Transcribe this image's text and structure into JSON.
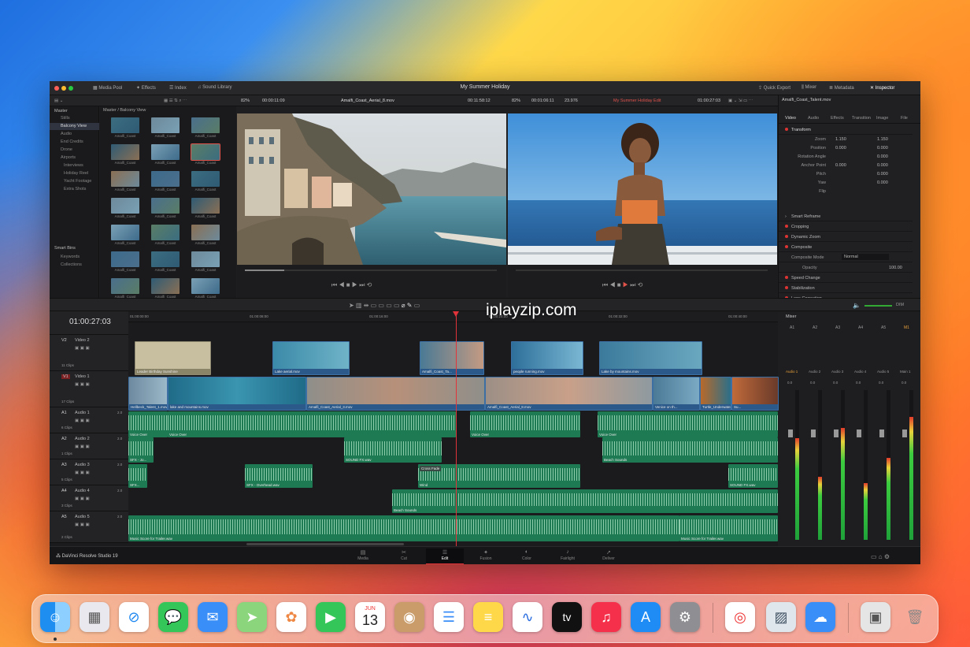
{
  "app": {
    "title": "My Summer Holiday",
    "brand": "DaVinci Resolve Studio 19"
  },
  "toolbar": {
    "left": [
      "Media Pool",
      "Effects",
      "Index",
      "Sound Library"
    ],
    "right": [
      "Quick Export",
      "Mixer",
      "Metadata",
      "Inspector"
    ]
  },
  "source_viewer": {
    "zoom": "82%",
    "timecode_in": "00:00:11:09",
    "clip_name": "Amalfi_Coast_Aerial_8.mov",
    "timecode_out": "00:11:58:12"
  },
  "timeline_viewer": {
    "zoom": "82%",
    "duration": "00:01:06:11",
    "fps": "23.976",
    "timeline_name": "My Summer Holiday Edit",
    "timecode": "01:00:27:03"
  },
  "media_pool": {
    "path": "Master / Balcony View",
    "bins": [
      "Master",
      "Stills",
      "Balcony View",
      "Audio",
      "End Credits",
      "Drone",
      "Airports",
      "Interviews",
      "Holiday Reel",
      "Yacht Footage",
      "Extra Shots"
    ],
    "smart_bins_label": "Smart Bins",
    "smart_bins": [
      "Keywords",
      "Collections"
    ],
    "clips": [
      "Amalfi_Coast",
      "Amalfi_Coast",
      "Amalfi_Coast",
      "Amalfi_Coast",
      "Amalfi_Coast",
      "Amalfi_Coast",
      "Amalfi_Coast",
      "Amalfi_Coast",
      "Amalfi_Coast",
      "Amalfi_Coast",
      "Amalfi_Coast",
      "Amalfi_Coast",
      "Amalfi_Coast",
      "Amalfi_Coast",
      "Amalfi_Coast",
      "Amalfi_Coast",
      "Amalfi_Coast",
      "Amalfi_Coast",
      "Amalfi_Coast",
      "Amalfi_Coast",
      "Amalfi_Coast",
      "Balcony_view",
      "Waterfall_tag",
      "Holiday_Track"
    ]
  },
  "inspector": {
    "clip_name": "Amalfi_Coast_Talent.mov",
    "tabs": [
      "Video",
      "Audio",
      "Effects",
      "Transition",
      "Image",
      "File"
    ],
    "transform_label": "Transform",
    "rows": [
      {
        "label": "Zoom",
        "x": "1.150",
        "y": "1.150"
      },
      {
        "label": "Position",
        "x": "0.000",
        "y": "0.000"
      },
      {
        "label": "Rotation Angle",
        "x": "",
        "y": "0.000"
      },
      {
        "label": "Anchor Point",
        "x": "0.000",
        "y": "0.000"
      },
      {
        "label": "Pitch",
        "x": "",
        "y": "0.000"
      },
      {
        "label": "Yaw",
        "x": "",
        "y": "0.000"
      },
      {
        "label": "Flip",
        "x": "",
        "y": ""
      }
    ],
    "sections": [
      "Smart Reframe",
      "Cropping",
      "Dynamic Zoom",
      "Composite"
    ],
    "composite_mode_label": "Composite Mode",
    "composite_mode_value": "Normal",
    "opacity_label": "Opacity",
    "opacity_value": "100.00",
    "more_sections": [
      "Speed Change",
      "Stabilization",
      "Lens Correction"
    ]
  },
  "timeline": {
    "timecode": "01:00:27:03",
    "ruler": [
      "01:00:00:00",
      "01:00:08:00",
      "01:00:16:00",
      "01:00:24:00",
      "01:00:32:00",
      "01:00:40:00"
    ],
    "tracks": [
      {
        "id": "V2",
        "name": "Video 2",
        "clips": "11 Clips"
      },
      {
        "id": "V1",
        "name": "Video 1",
        "clips": "17 Clips"
      },
      {
        "id": "A1",
        "name": "Audio 1",
        "clips": "6 Clips",
        "ch": "2.0"
      },
      {
        "id": "A2",
        "name": "Audio 2",
        "clips": "1 Clips",
        "ch": "2.0"
      },
      {
        "id": "A3",
        "name": "Audio 3",
        "clips": "5 Clips",
        "ch": "2.0"
      },
      {
        "id": "A4",
        "name": "Audio 4",
        "clips": "3 Clips",
        "ch": "2.0"
      },
      {
        "id": "A5",
        "name": "Audio 5",
        "clips": "2 Clips",
        "ch": "2.0"
      }
    ],
    "v2_clips": [
      "Leader Birthday Sunshine",
      "Lake aerial.mov",
      "Amalfi_Coast_Ta...",
      "people running.mov",
      "Lake by mountains.mov"
    ],
    "v1_clips": [
      "Hellbeck_Talent_1.mov",
      "lake and mountains.mov",
      "Amalfi_Coast_Aerial_3.mov",
      "Amalfi_Coast_Aerial_8.mov",
      "Venice on th...",
      "Turtle_Underwater...",
      "Su..."
    ],
    "a1_clips": [
      "Voice Over",
      "Voice Over",
      "Voice Over",
      "Voice Over"
    ],
    "a2_clips": [
      "SFX - Jo...",
      "SOUND FX.wav",
      "Beach Sounds"
    ],
    "a3_clips": [
      "SFX...",
      "SFX - Overhead.wav",
      "Wind",
      "SOUND FX.wav"
    ],
    "a3_label": "Cross Fade",
    "a4_clips": [
      "Beach Sounds"
    ],
    "a5_clips": [
      "Music Score for Trailer.wav",
      "Music Score for Trailer.wav"
    ]
  },
  "mixer": {
    "title": "Mixer",
    "inputs": [
      "A1",
      "A2",
      "A3",
      "A4",
      "A5",
      "M1"
    ],
    "channels": [
      "Audio 1",
      "Audio 2",
      "Audio 3",
      "Audio 4",
      "Audio 5",
      "Main 1"
    ],
    "level": "DIM",
    "db_label": "0.0",
    "meter_levels": [
      0.68,
      0.42,
      0.75,
      0.38,
      0.55,
      0.82
    ]
  },
  "pages": [
    "Media",
    "Cut",
    "Edit",
    "Fusion",
    "Color",
    "Fairlight",
    "Deliver"
  ],
  "active_page": "Edit",
  "watermark": "iplayzip.com",
  "dock": {
    "apps": [
      "Finder",
      "Launchpad",
      "Safari",
      "Messages",
      "Mail",
      "Maps",
      "Photos",
      "FaceTime",
      "Calendar",
      "Contacts",
      "Reminders",
      "Notes",
      "Freeform",
      "TV",
      "Music",
      "App Store",
      "System Settings",
      "Chrome",
      "Preview",
      "Weather",
      "Photo Booth",
      "Trash"
    ],
    "calendar_month": "JUN",
    "calendar_day": "13",
    "tv_label": "tv"
  }
}
